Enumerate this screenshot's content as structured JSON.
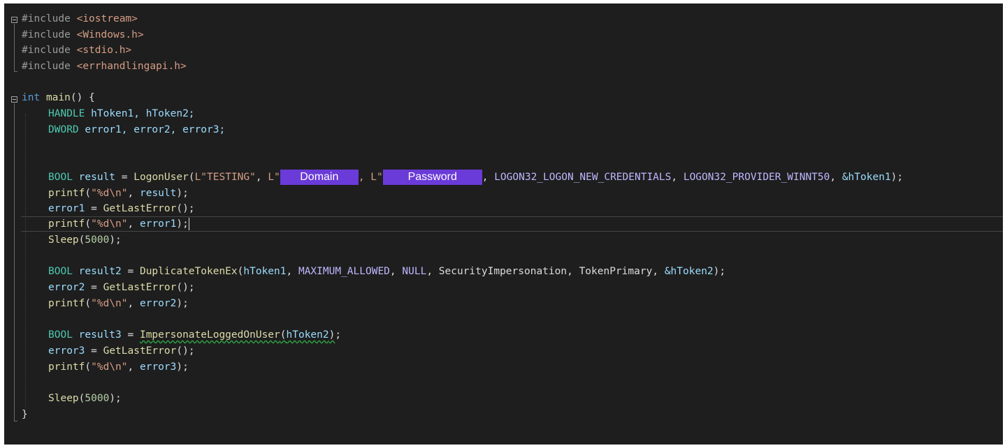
{
  "editor": {
    "includes": [
      "iostream",
      "Windows.h",
      "stdio.h",
      "errhandlingapi.h"
    ],
    "include_keyword": "#include",
    "main_signature": {
      "return_type": "int",
      "name": "main",
      "rest": "() {"
    },
    "decl_handle": {
      "type": "HANDLE",
      "vars": "hToken1, hToken2;"
    },
    "decl_dword": {
      "type": "DWORD",
      "vars": "error1, error2, error3;"
    },
    "logon_line": {
      "type": "BOOL",
      "var": "result",
      "eq": " = ",
      "fn": "LogonUser",
      "arg1": "L\"TESTING\"",
      "sep1": ", ",
      "arg2_prefix": "L\"",
      "redacted_domain": "Domain",
      "sep2": ", L\"",
      "redacted_password": "Password",
      "sep3": ", ",
      "macro1": "LOGON32_LOGON_NEW_CREDENTIALS",
      "macro2": "LOGON32_PROVIDER_WINNT50",
      "tail_ref": "&hToken1",
      "end": ");"
    },
    "printf_result": {
      "fn": "printf",
      "fmt": "\"%d\\n\"",
      "arg": "result"
    },
    "error1_line": {
      "var": "error1",
      "fn": "GetLastError",
      "end": "();"
    },
    "printf_error1": {
      "fn": "printf",
      "fmt": "\"%d\\n\"",
      "arg": "error1"
    },
    "sleep1": {
      "fn": "Sleep",
      "value": "5000"
    },
    "dup_line": {
      "type": "BOOL",
      "var": "result2",
      "fn": "DuplicateTokenEx",
      "arg1": "hToken1",
      "arg2": "MAXIMUM_ALLOWED",
      "arg3": "NULL",
      "arg4": "SecurityImpersonation",
      "arg5": "TokenPrimary",
      "arg6": "&hToken2"
    },
    "error2_line": {
      "var": "error2",
      "fn": "GetLastError"
    },
    "printf_error2": {
      "fn": "printf",
      "fmt": "\"%d\\n\"",
      "arg": "error2"
    },
    "imp_line": {
      "type": "BOOL",
      "var": "result3",
      "fn": "ImpersonateLoggedOnUser",
      "arg": "hToken2"
    },
    "error3_line": {
      "var": "error3",
      "fn": "GetLastError"
    },
    "printf_error3": {
      "fn": "printf",
      "fmt": "\"%d\\n\"",
      "arg": "error3"
    },
    "sleep2": {
      "fn": "Sleep",
      "value": "5000"
    },
    "closing_brace": "}"
  },
  "colors": {
    "background": "#1e1e1e",
    "keyword": "#569cd6",
    "type": "#4ec9b0",
    "function": "#dcdcaa",
    "variable": "#9cdcfe",
    "macro": "#beb7ff",
    "string": "#d69d85",
    "redaction": "#6a3bd8"
  }
}
